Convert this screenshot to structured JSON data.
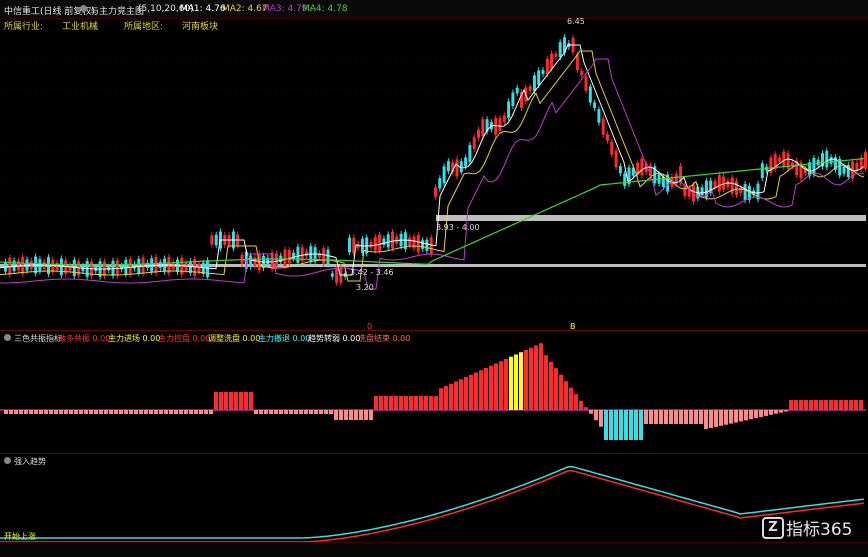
{
  "header": {
    "stock_name": "中信重工(日线 前复权)",
    "indicator_name": "与主力竞主图",
    "params": "(5,10,20,60)",
    "ma1_label": "MA1: 4.76",
    "ma2_label": "MA2: 4.67",
    "ma3_label": "MA3: 4.79",
    "ma4_label": "MA4: 4.78"
  },
  "info_row": {
    "industry_label": "所属行业:",
    "industry_value": "工业机械",
    "region_label": "所属地区:",
    "region_value": "河南板块"
  },
  "price_panel": {
    "high_annotation": "6.45",
    "low_annotation": "3.20",
    "zone_upper_label": "3.93 - 4.00",
    "zone_lower_label": "3.42 - 3.46"
  },
  "markers": {
    "marker_a": "0",
    "marker_b": "B"
  },
  "macd_panel": {
    "title": "三色共振指标",
    "items": [
      {
        "label": "做多共振",
        "value": "0.00",
        "color": "#ff3333"
      },
      {
        "label": "主力进场",
        "value": "0.00",
        "color": "#ffff00"
      },
      {
        "label": "主力控盘",
        "value": "0.00",
        "color": "#ff3333"
      },
      {
        "label": "调整洗盘",
        "value": "0.00",
        "color": "#ffff00"
      },
      {
        "label": "主力撤退",
        "value": "0.00",
        "color": "#33ffff"
      },
      {
        "label": "趋势转弱",
        "value": "0.00",
        "color": "#ffffff"
      },
      {
        "label": "洗盘结束",
        "value": "0.00",
        "color": "#ff6666"
      }
    ]
  },
  "lower_panel": {
    "title": "强入趋势",
    "corner_label": "开始上涨"
  },
  "watermark": {
    "brand": "指标365",
    "mark": "Z"
  },
  "colors": {
    "up": "#ff2a2a",
    "down": "#33e0e8",
    "ma_white": "#ffffff",
    "ma_yellow": "#e6d23a",
    "ma_purple": "#c23cc8",
    "ma_green": "#36d836",
    "support_band": "#bdbdbd"
  }
}
